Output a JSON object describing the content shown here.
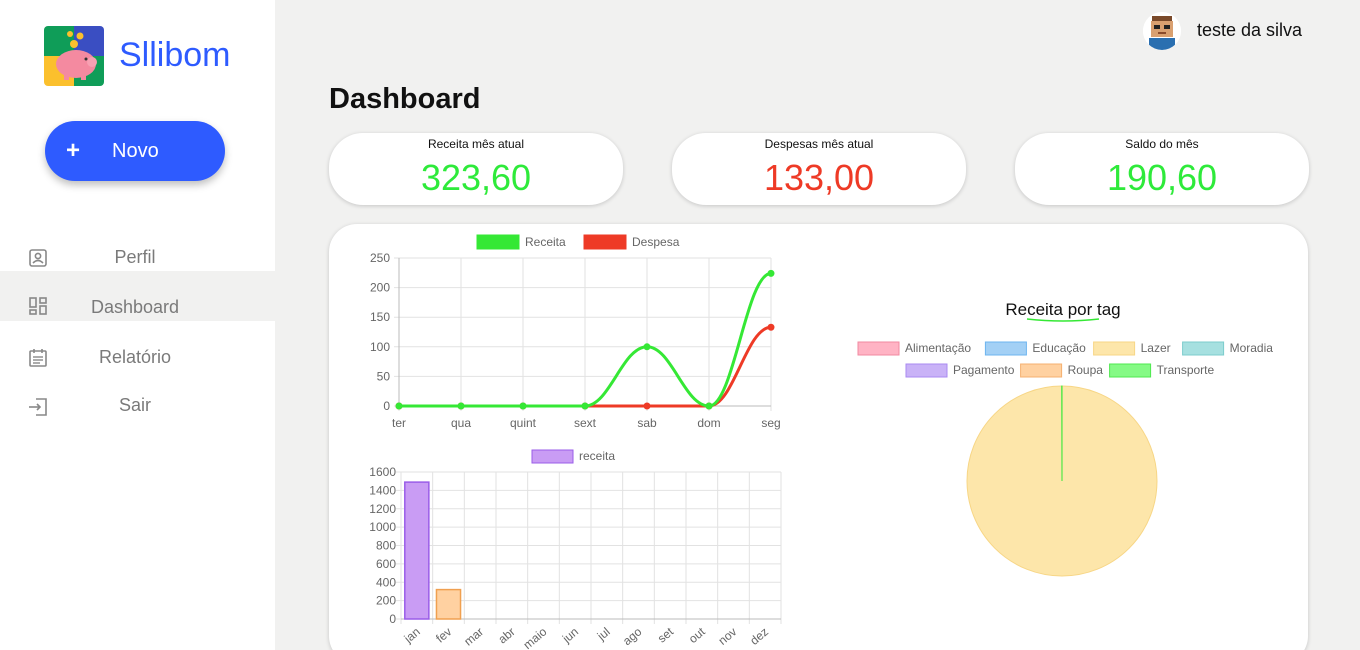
{
  "brand": {
    "name": "Sllibom"
  },
  "new_button": {
    "icon": "+",
    "label": "Novo"
  },
  "nav": [
    {
      "label": "Perfil",
      "icon": "profile-icon"
    },
    {
      "label": "Dashboard",
      "icon": "dashboard-icon",
      "active": true
    },
    {
      "label": "Relatório",
      "icon": "report-icon"
    },
    {
      "label": "Sair",
      "icon": "logout-icon"
    }
  ],
  "user": {
    "name": "teste da silva"
  },
  "page": {
    "title": "Dashboard"
  },
  "cards": [
    {
      "title": "Receita mês atual",
      "value": "323,60",
      "color": "#2eea3a"
    },
    {
      "title": "Despesas mês atual",
      "value": "133,00",
      "color": "#ee3a26"
    },
    {
      "title": "Saldo do mês",
      "value": "190,60",
      "color": "#2eea3a"
    }
  ],
  "colors": {
    "brand": "#2e5bff",
    "receita": "#35e835",
    "despesa": "#ee3a26"
  },
  "chart_data": [
    {
      "type": "line",
      "categories": [
        "ter",
        "qua",
        "quint",
        "sext",
        "sab",
        "dom",
        "seg"
      ],
      "series": [
        {
          "name": "Receita",
          "color": "#35e835",
          "values": [
            0,
            0,
            0,
            0,
            100,
            0,
            224
          ]
        },
        {
          "name": "Despesa",
          "color": "#ee3a26",
          "values": [
            0,
            0,
            0,
            0,
            0,
            0,
            133
          ]
        }
      ],
      "ylim": [
        0,
        250
      ],
      "yticks": [
        "0",
        "50",
        "100",
        "150",
        "200",
        "250"
      ],
      "grid": true,
      "legend": "top"
    },
    {
      "type": "bar",
      "categories": [
        "jan",
        "fev",
        "mar",
        "abr",
        "maio",
        "jun",
        "jul",
        "ago",
        "set",
        "out",
        "nov",
        "dez"
      ],
      "series": [
        {
          "name": "receita",
          "values": [
            1490,
            320,
            0,
            0,
            0,
            0,
            0,
            0,
            0,
            0,
            0,
            0
          ]
        }
      ],
      "bar_colors": [
        "#c99cf4",
        "#ffd1a1"
      ],
      "ylim": [
        0,
        1600
      ],
      "yticks": [
        "0",
        "200",
        "400",
        "600",
        "800",
        "1000",
        "1200",
        "1400",
        "1600"
      ],
      "grid": true,
      "legend": "top"
    },
    {
      "type": "pie",
      "title": "Receita por tag",
      "labels": [
        "Alimentação",
        "Educação",
        "Lazer",
        "Moradia",
        "Pagamento",
        "Roupa",
        "Transporte"
      ],
      "colors": [
        "#ffb3c4",
        "#a3d0f5",
        "#fde6aa",
        "#a6e0e0",
        "#c9b2f7",
        "#ffd1a1",
        "#85fa85"
      ],
      "values": [
        0,
        0,
        100,
        0,
        0,
        0,
        0.05
      ],
      "legend": "top"
    }
  ]
}
